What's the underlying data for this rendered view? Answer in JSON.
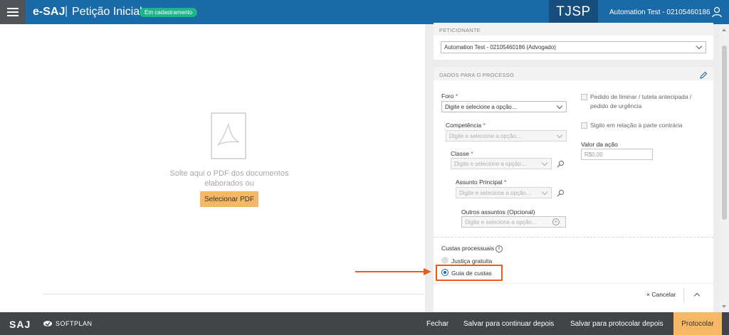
{
  "header": {
    "brand": "e-SAJ",
    "separator": "|",
    "page_title": "Petição Inicial",
    "status_badge": "Em cadastramento",
    "court": "TJSP",
    "user": "Automation Test - 02105460186"
  },
  "pdf_area": {
    "drop_text": "Solte aqui o PDF dos documentos elaborados ou",
    "select_button": "Selecionar PDF"
  },
  "peticionante": {
    "header": "PETICIONANTE",
    "selected": "Automation Test - 02105460186 (Advogado)"
  },
  "process_data": {
    "header": "DADOS PARA O PROCESSO",
    "placeholder": "Digite e selecione a opção...",
    "required_mark": "*",
    "foro_label": "Foro",
    "competencia_label": "Competência",
    "classe_label": "Classe",
    "assunto_label": "Assunto Principal",
    "outros_label": "Outros assuntos (Opcional)",
    "liminar_label": "Pedido de liminar / tutela antecipada / pedido de urgência",
    "sigilo_label": "Sigilo em relação à parte contrária",
    "valor_label": "Valor da ação",
    "valor_placeholder": "R$0,00"
  },
  "custas": {
    "label": "Custas processuais",
    "info_glyph": "i",
    "options": [
      "Justiça gratuita",
      "Guia de custas"
    ],
    "selected": "Guia de custas"
  },
  "actions": {
    "cancel": "× Cancelar"
  },
  "footer": {
    "saj_logo": "SAJ",
    "softplan_logo": "SOFTPLAN",
    "close": "Fechar",
    "save_continue": "Salvar para continuar depois",
    "save_protocol": "Salvar para protocolar depois",
    "protocol": "Protocolar"
  },
  "colors": {
    "header_bg": "#1a6aa8",
    "badge": "#1db58a",
    "accent_button": "#f7b866",
    "highlight": "#ef5a1c",
    "footer_bg": "#424547"
  }
}
